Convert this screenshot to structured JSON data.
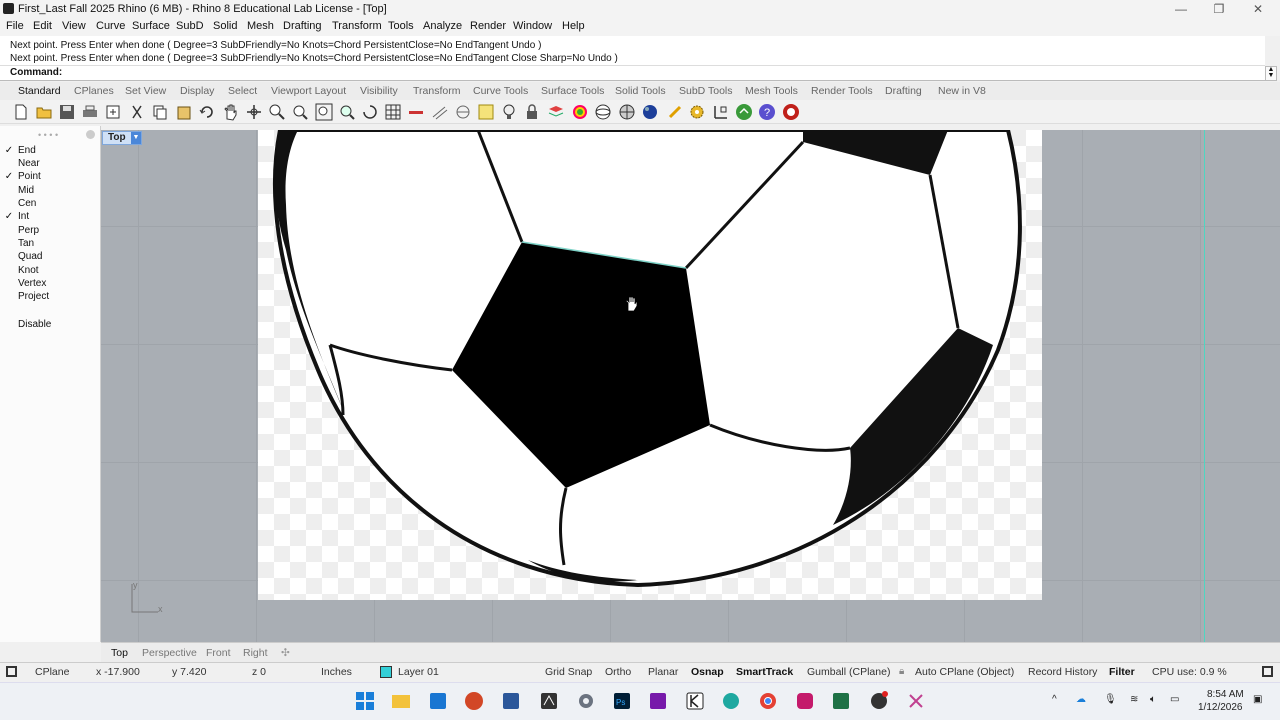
{
  "window": {
    "title": "First_Last Fall 2025 Rhino (6 MB) - Rhino 8 Educational Lab License - [Top]",
    "minimize": "—",
    "maximize": "❐",
    "close": "✕"
  },
  "menu": [
    "File",
    "Edit",
    "View",
    "Curve",
    "Surface",
    "SubD",
    "Solid",
    "Mesh",
    "Drafting",
    "Transform",
    "Tools",
    "Analyze",
    "Render",
    "Window",
    "Help"
  ],
  "command_history": [
    "Next point. Press Enter when done ( Degree=3  SubDFriendly=No  Knots=Chord  PersistentClose=No  EndTangent  Undo )",
    "Next point. Press Enter when done ( Degree=3  SubDFriendly=No  Knots=Chord  PersistentClose=No  EndTangent  Close  Sharp=No  Undo )"
  ],
  "command_label": "Command:",
  "toolbar_tabs": [
    "Standard",
    "CPlanes",
    "Set View",
    "Display",
    "Select",
    "Viewport Layout",
    "Visibility",
    "Transform",
    "Curve Tools",
    "Surface Tools",
    "Solid Tools",
    "SubD Tools",
    "Mesh Tools",
    "Render Tools",
    "Drafting",
    "New in V8"
  ],
  "toolbar_icons": [
    "new-file-icon",
    "open-icon",
    "save-icon",
    "print-icon",
    "import-icon",
    "cut-icon",
    "copy-icon",
    "paste-icon",
    "undo-icon",
    "pan-icon",
    "rotate-view-icon",
    "zoom-icon",
    "zoom-window-icon",
    "zoom-extents-icon",
    "zoom-selected-icon",
    "rotate-icon",
    "grid-icon",
    "point-icon",
    "points-icon",
    "car-icon",
    "hatch-icon",
    "curve-icon",
    "lightbulb-icon",
    "lock-icon",
    "layer-icon",
    "color-wheel-icon",
    "sphere-icon",
    "mesh-sphere-icon",
    "blue-sphere-icon",
    "snap-icon",
    "gear-icon",
    "gumball-icon",
    "grasshopper-icon",
    "help-icon",
    "rhino-icon"
  ],
  "osnap": [
    {
      "label": "End",
      "checked": true
    },
    {
      "label": "Near",
      "checked": false
    },
    {
      "label": "Point",
      "checked": true
    },
    {
      "label": "Mid",
      "checked": false
    },
    {
      "label": "Cen",
      "checked": false
    },
    {
      "label": "Int",
      "checked": true
    },
    {
      "label": "Perp",
      "checked": false
    },
    {
      "label": "Tan",
      "checked": false
    },
    {
      "label": "Quad",
      "checked": false
    },
    {
      "label": "Knot",
      "checked": false
    },
    {
      "label": "Vertex",
      "checked": false
    },
    {
      "label": "Project",
      "checked": false
    }
  ],
  "osnap_disable": "Disable",
  "viewport": {
    "name": "Top",
    "axis_x": "x",
    "axis_y": "y"
  },
  "viewport_tabs": [
    "Top",
    "Perspective",
    "Front",
    "Right"
  ],
  "status": {
    "cplane": "CPlane",
    "x": "x -17.900",
    "y": "y 7.420",
    "z": "z 0",
    "units": "Inches",
    "layer": "Layer 01",
    "layer_color": "#34d0d8",
    "grid_snap": "Grid Snap",
    "ortho": "Ortho",
    "planar": "Planar",
    "osnap": "Osnap",
    "smarttrack": "SmartTrack",
    "gumball": "Gumball (CPlane)",
    "autocplane": "Auto CPlane (Object)",
    "record_history": "Record History",
    "filter": "Filter",
    "cpu": "CPU use: 0.9 %"
  },
  "tray": {
    "time": "8:54 AM",
    "date": "1/12/2026"
  }
}
